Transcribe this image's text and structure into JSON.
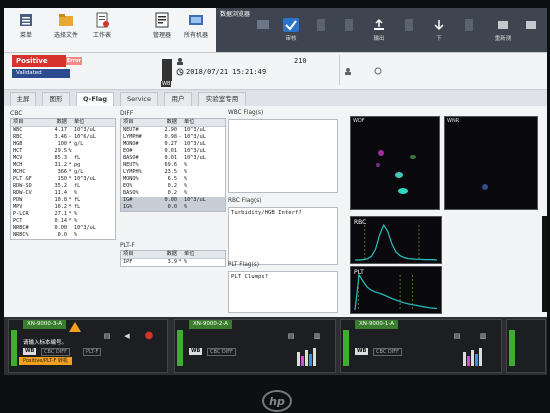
{
  "toolbar": {
    "buttons": [
      {
        "label": "菜单",
        "icon": "menu-icon"
      },
      {
        "label": "选择文件",
        "icon": "folder-icon"
      },
      {
        "label": "工作表",
        "icon": "worksheet-icon"
      },
      {
        "label": "管理器",
        "icon": "manager-icon"
      },
      {
        "label": "所有机器",
        "icon": "analyzers-icon"
      }
    ],
    "browser_title": "数据浏览器",
    "dark_buttons": [
      {
        "label": "",
        "icon": "monitor-icon"
      },
      {
        "label": "审核",
        "icon": "validate-icon",
        "selected": true
      },
      {
        "label": "",
        "icon": "doc-icon"
      },
      {
        "label": "",
        "icon": "doc2-icon"
      },
      {
        "label": "输出",
        "icon": "output-icon"
      },
      {
        "label": "",
        "icon": "doc3-icon"
      },
      {
        "label": "下",
        "icon": "down-arrow-icon"
      },
      {
        "label": "",
        "icon": "doc4-icon"
      },
      {
        "label": "重新测",
        "icon": "rerun-icon"
      },
      {
        "label": "",
        "icon": "more-icon"
      }
    ]
  },
  "status": {
    "positive": "Positive",
    "error_tag": "Error",
    "validated": "Validated",
    "wb": "WB",
    "sample_no": "210",
    "datetime": "2018/07/21 15:21:49"
  },
  "tabs": [
    "主屏",
    "图形",
    "Q-Flag",
    "Service",
    "用户",
    "实验室专用"
  ],
  "active_tab": 2,
  "cbc": {
    "title": "CBC",
    "headers": [
      "项目",
      "数据",
      "",
      "单位"
    ],
    "rows": [
      [
        "WBC",
        "4.17",
        "",
        "10^3/uL"
      ],
      [
        "RBC",
        "3.46",
        "-",
        "10^6/uL"
      ],
      [
        "HGB",
        "100",
        "*",
        "g/L"
      ],
      [
        "HCT",
        "29.5",
        "%",
        ""
      ],
      [
        "MCV",
        "85.3",
        "",
        "fL"
      ],
      [
        "MCH",
        "31.2",
        "*",
        "pg"
      ],
      [
        "MCHC",
        "366",
        "*",
        "g/L"
      ],
      [
        "PLT &F",
        "150",
        "*",
        "10^3/uL"
      ],
      [
        "RDW-SD",
        "35.2",
        "",
        "fL"
      ],
      [
        "RDW-CV",
        "11.4",
        "",
        "%"
      ],
      [
        "PDW",
        "10.8",
        "*",
        "fL"
      ],
      [
        "MPV",
        "10.2",
        "*",
        "fL"
      ],
      [
        "P-LCR",
        "27.1",
        "*",
        "%"
      ],
      [
        "PCT",
        "0.14",
        "*",
        "%"
      ],
      [
        "NRBC#",
        "0.00",
        "",
        "10^3/uL"
      ],
      [
        "NRBC%",
        "0.0",
        "",
        "%"
      ]
    ]
  },
  "diff": {
    "title": "DIFF",
    "headers": [
      "项目",
      "数据",
      "",
      "单位"
    ],
    "rows": [
      [
        "NEUT#",
        "2.90",
        "",
        "10^3/uL"
      ],
      [
        "LYMPH#",
        "0.98",
        "-",
        "10^3/uL"
      ],
      [
        "MONO#",
        "0.27",
        "",
        "10^3/uL"
      ],
      [
        "EO#",
        "0.01",
        "",
        "10^3/uL"
      ],
      [
        "BASO#",
        "0.01",
        "",
        "10^3/uL"
      ],
      [
        "NEUT%",
        "69.6",
        "",
        "%"
      ],
      [
        "LYMPH%",
        "23.5",
        "",
        "%"
      ],
      [
        "MONO%",
        "6.5",
        "",
        "%"
      ],
      [
        "EO%",
        "0.2",
        "",
        "%"
      ],
      [
        "BASO%",
        "0.2",
        "",
        "%"
      ],
      [
        "IG#",
        "0.00",
        "",
        "10^3/uL"
      ],
      [
        "IG%",
        "0.0",
        "",
        "%"
      ]
    ]
  },
  "pltf": {
    "title": "PLT-F",
    "headers": [
      "项目",
      "数据",
      "",
      "单位"
    ],
    "rows": [
      [
        "IPF",
        "3.9",
        "*",
        "%"
      ]
    ]
  },
  "flags": {
    "wbc_title": "WBC Flag(s)",
    "wbc_text": "",
    "rbc_title": "RBC Flag(s)",
    "rbc_text": "Turbidity/HGB Interf?",
    "plt_title": "PLT Flag(s)",
    "plt_text": "PLT Clumps?"
  },
  "graphs": {
    "wdf": "WDF",
    "wnr": "WNR",
    "rbc": "RBC",
    "plt": "PLT"
  },
  "analyzers": [
    {
      "name": "XN-9000-3-A",
      "message": "请输入标本编号。",
      "mode": "CBC DIFF",
      "extra": "PLT-F",
      "orange": "Positive/PLT-F 转机"
    },
    {
      "name": "XN-9000-2-A",
      "message": "",
      "mode": "CBC DIFF",
      "extra": "",
      "orange": ""
    },
    {
      "name": "XN-9000-1-A",
      "message": "",
      "mode": "CBC DIFF",
      "extra": "",
      "orange": ""
    }
  ],
  "colors": {
    "positive": "#d8322c",
    "validated": "#2d4b8f",
    "analyzer_green": "#3fae2f",
    "warning": "#f2a01e",
    "histogram": "#28c0c0"
  },
  "chart_data": [
    {
      "type": "area",
      "title": "RBC",
      "x": [
        0,
        5,
        10,
        15,
        20,
        25,
        30,
        35,
        40,
        45,
        50,
        55,
        60,
        65,
        70,
        75,
        80,
        85,
        90,
        95,
        100
      ],
      "values": [
        0,
        0,
        1,
        3,
        10,
        30,
        70,
        98,
        80,
        45,
        22,
        12,
        7,
        4,
        3,
        2,
        2,
        1,
        1,
        1,
        0
      ]
    },
    {
      "type": "area",
      "title": "PLT",
      "x": [
        0,
        5,
        10,
        15,
        20,
        25,
        30,
        35,
        40,
        45,
        50,
        55,
        60,
        65,
        70,
        75,
        80,
        85,
        90,
        95,
        100
      ],
      "values": [
        0,
        92,
        75,
        60,
        52,
        47,
        44,
        40,
        35,
        30,
        26,
        22,
        19,
        16,
        14,
        12,
        10,
        8,
        6,
        5,
        4
      ]
    }
  ]
}
